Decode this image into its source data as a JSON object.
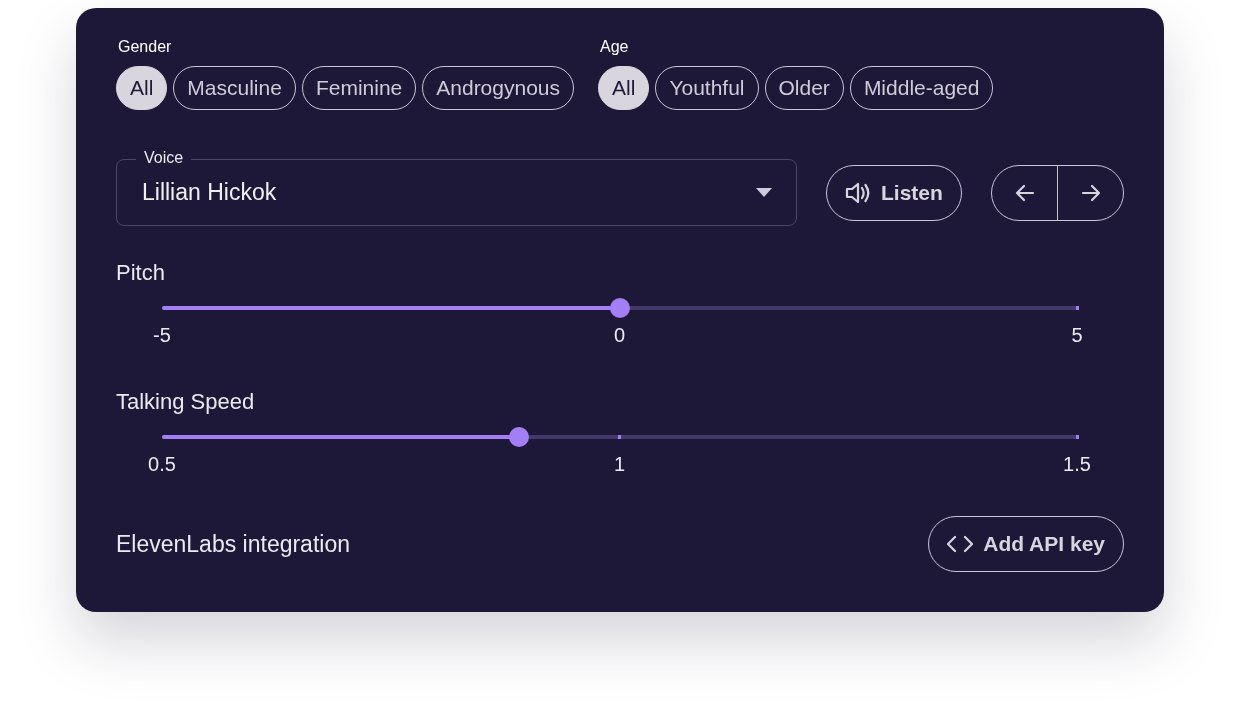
{
  "filters": [
    {
      "label": "Gender",
      "options": [
        {
          "label": "All",
          "selected": true
        },
        {
          "label": "Masculine",
          "selected": false
        },
        {
          "label": "Feminine",
          "selected": false
        },
        {
          "label": "Androgynous",
          "selected": false
        }
      ]
    },
    {
      "label": "Age",
      "options": [
        {
          "label": "All",
          "selected": true
        },
        {
          "label": "Youthful",
          "selected": false
        },
        {
          "label": "Older",
          "selected": false
        },
        {
          "label": "Middle-aged",
          "selected": false
        }
      ]
    }
  ],
  "voice": {
    "label": "Voice",
    "value": "Lillian Hickok"
  },
  "listen_button": "Listen",
  "sliders": [
    {
      "label": "Pitch",
      "level": 0.5,
      "ticks": [
        "-5",
        "0",
        "5"
      ]
    },
    {
      "label": "Talking Speed",
      "level": 0.39,
      "ticks": [
        "0.5",
        "1",
        "1.5"
      ]
    }
  ],
  "integration": {
    "label": "ElevenLabs integration",
    "button": "Add API key"
  }
}
